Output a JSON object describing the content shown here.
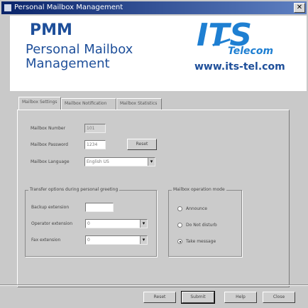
{
  "window": {
    "title": "Personal Mailbox Management",
    "close_glyph": "✕"
  },
  "banner": {
    "title": "PMM",
    "subtitle_line1": "Personal Mailbox",
    "subtitle_line2": "Management",
    "logo": {
      "text": "ITS",
      "sub": "Telecom",
      "color": "#1e7fd2"
    },
    "url": "www.its-tel.com"
  },
  "tabs": [
    {
      "label": "Mailbox Settings",
      "active": true
    },
    {
      "label": "Mailbox Notification",
      "active": false
    },
    {
      "label": "Mailbox Statistics",
      "active": false
    }
  ],
  "mailbox_settings": {
    "number_label": "Mailbox Number",
    "number_value": "101",
    "password_label": "Mailbox Password",
    "password_value": "1234",
    "reset_button": "Reset",
    "language_label": "Mailbox Language",
    "language_value": "English US"
  },
  "call_options": {
    "group_title": "Transfer options during personal greeting",
    "backup_label": "Backup extension",
    "backup_value": "",
    "operator_label": "Operator extension",
    "operator_value": "0",
    "fax_label": "Fax extension",
    "fax_value": "0"
  },
  "operation_mode": {
    "group_title": "Mailbox operation mode",
    "options": [
      {
        "label": "Announce",
        "selected": false
      },
      {
        "label": "Do Not disturb",
        "selected": false
      },
      {
        "label": "Take message",
        "selected": true
      }
    ]
  },
  "footer_buttons": {
    "reset": "Reset",
    "submit": "Submit",
    "help": "Help",
    "close": "Close"
  },
  "colors": {
    "brand": "#1e4f9a",
    "titlebar": "#0a246a"
  }
}
